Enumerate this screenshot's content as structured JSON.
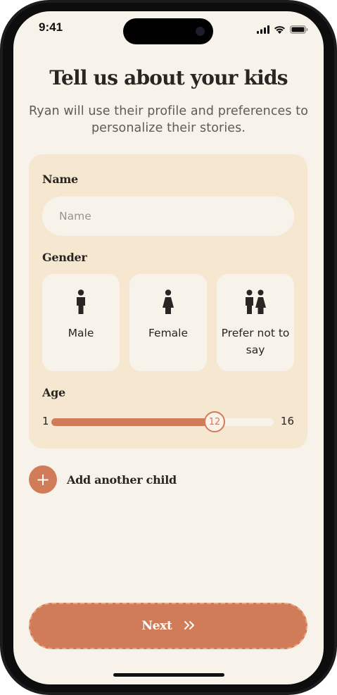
{
  "status_bar": {
    "time": "9:41",
    "signal_icon": "cellular-signal-icon",
    "wifi_icon": "wifi-icon",
    "battery_icon": "battery-icon"
  },
  "header": {
    "title": "Tell us about your kids",
    "subtitle": "Ryan will use their profile and preferences to personalize their stories."
  },
  "form": {
    "name": {
      "label": "Name",
      "placeholder": "Name",
      "value": ""
    },
    "gender": {
      "label": "Gender",
      "options": [
        {
          "label": "Male",
          "icon": "male-person-icon"
        },
        {
          "label": "Female",
          "icon": "female-person-icon"
        },
        {
          "label": "Prefer not to say",
          "icon": "people-pair-icon"
        }
      ]
    },
    "age": {
      "label": "Age",
      "min": 1,
      "max": 16,
      "value": 12
    }
  },
  "add_child": {
    "label": "Add another child",
    "icon": "plus-icon"
  },
  "next_button": {
    "label": "Next",
    "icon": "double-chevron-right-icon"
  },
  "colors": {
    "background": "#f8f3ea",
    "card": "#f6e7d0",
    "accent": "#d07c58",
    "text": "#2a2522"
  }
}
